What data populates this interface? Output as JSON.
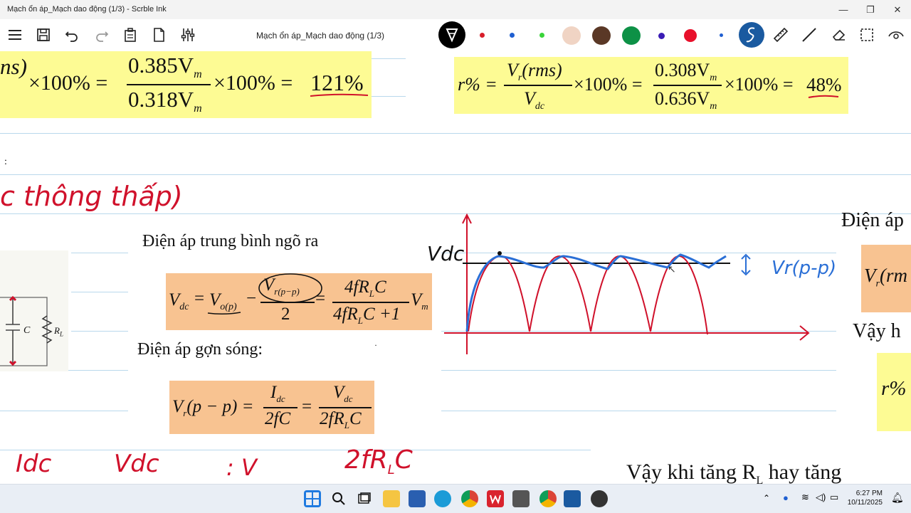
{
  "window": {
    "title": "Mạch ổn áp_Mạch dao động (1/3) - Scrble Ink",
    "minimize": "—",
    "maximize": "❐",
    "close": "✕"
  },
  "toolbar": {
    "doc_title": "Mạch ổn áp_Mạch dao động (1/3)",
    "left_icons": [
      "menu-icon",
      "save-icon",
      "undo-icon",
      "redo-icon",
      "clipboard-icon",
      "new-page-icon",
      "settings-sliders-icon"
    ],
    "pen_colors": [
      "#d81e2a",
      "#1f5fd1",
      "#39d43a",
      "#f0d4c4",
      "#5a3826",
      "#0d9146",
      "#3a1cb5",
      "#e8102b",
      "#1f5fd1"
    ],
    "right_icons": [
      "lasso-pen-icon",
      "ruler-icon",
      "line-tool-icon",
      "eraser-icon",
      "select-tool-icon",
      "view-icon"
    ]
  },
  "slide": {
    "top_left_formula": {
      "prefix": "ns)",
      "times100": "×100% =",
      "num": "0.385V",
      "den": "0.318V",
      "sub": "m",
      "result_mid": "×100% =",
      "result": "121%"
    },
    "top_right_formula": {
      "lhs": "r% =",
      "num": "V",
      "num_sub": "r",
      "num_tail": "(rms)",
      "den": "V",
      "den_sub": "dc",
      "mid": "×100% =",
      "num2": "0.308V",
      "den2": "0.636V",
      "sub": "m",
      "tail": "×100% =",
      "result": "48%"
    },
    "handwritten_title": "c thông thấp)",
    "heading_avg": "Điện áp trung bình ngõ ra",
    "vdc_formula": {
      "lhs": "V",
      "lhs_sub": "dc",
      "eq": "=",
      "v_o": "V",
      "v_o_sub": "o(p)",
      "minus": "−",
      "vr": "V",
      "vr_sub": "r(p−p)",
      "two": "2",
      "eq2": "=",
      "num": "4fR",
      "num_sub": "L",
      "num_tail": "C",
      "den": "4fR",
      "den_sub": "L",
      "den_tail": "C +1",
      "vm": "V",
      "vm_sub": "m"
    },
    "heading_ripple": "Điện áp gợn sóng:",
    "ripple_formula": {
      "lhs": "V",
      "lhs_sub": "r",
      "lhs_tail": "(p − p) =",
      "num1": "I",
      "num1_sub": "dc",
      "den1": "2fC",
      "eq": "=",
      "num2": "V",
      "num2_sub": "dc",
      "den2": "2fR",
      "den2_sub": "L",
      "den2_tail": "C"
    },
    "circuit_labels": {
      "c": "C",
      "rl": "R",
      "rl_sub": "L"
    },
    "graph_labels": {
      "vdc": "Vdc",
      "vr": "Vr(p-p)",
      "arrow": "↕"
    },
    "right_col": {
      "dien_ap": "Điện áp",
      "vr_box": "V",
      "vr_box_sub": "r",
      "vr_box_tail": "(rm",
      "vay_h": "Vậy h",
      "r_pct": "r%"
    },
    "bottom_text": "Vậy khi tăng R",
    "bottom_sub": "L",
    "bottom_tail": " hay tăng",
    "bottom_handwriting": {
      "idc": "Idc",
      "vdc": "Vdc",
      "v": ": V",
      "f": "2fR",
      "f_sub": "L",
      "f_tail": "C"
    }
  },
  "taskbar": {
    "apps": [
      "windows-start-icon",
      "search-icon",
      "task-view-icon",
      "file-explorer-icon",
      "store-icon",
      "edge-icon",
      "chrome-icon",
      "wps-icon",
      "phone-link-icon",
      "chrome-profile-icon",
      "scrble-ink-icon",
      "app-icon"
    ],
    "time": "6:27 PM",
    "date": "10/11/2025"
  }
}
